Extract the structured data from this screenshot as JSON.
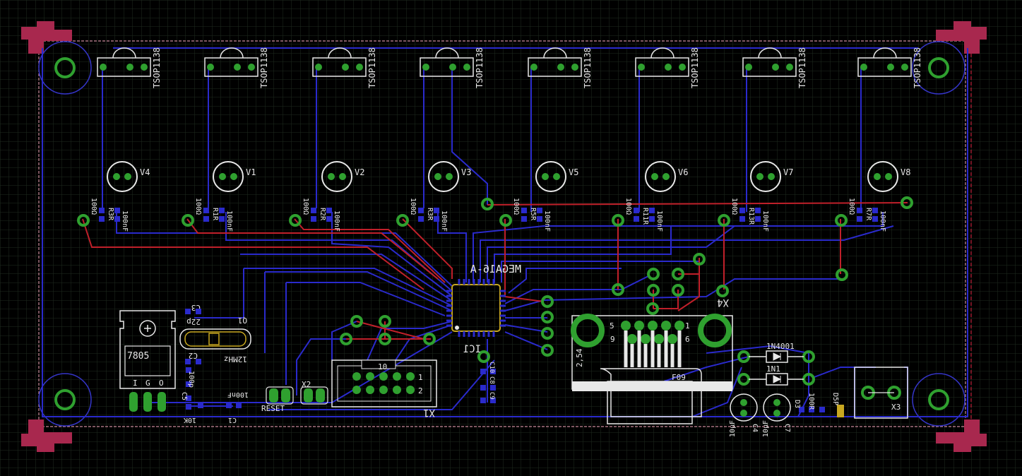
{
  "view": {
    "background": "#000000",
    "grid_color": "#1d2a1d"
  },
  "colors": {
    "bottom_trace": "#2a2acc",
    "top_trace": "#c0202a",
    "pad": "#2fa02f",
    "pad_hole": "#ffffff",
    "silk": "#e8e8e8",
    "mount_ring": "#3535c8",
    "corner_marker": "#a8284e",
    "outline": "#c88a9a"
  },
  "receivers": [
    {
      "label": "TSOP1138"
    },
    {
      "label": "TSOP1138"
    },
    {
      "label": "TSOP1138"
    },
    {
      "label": "TSOP1138"
    },
    {
      "label": "TSOP1138"
    },
    {
      "label": "TSOP1138"
    },
    {
      "label": "TSOP1138"
    },
    {
      "label": "TSOP1138"
    }
  ],
  "leds": [
    {
      "label": "V4"
    },
    {
      "label": "V1"
    },
    {
      "label": "V2"
    },
    {
      "label": "V3"
    },
    {
      "label": "V5"
    },
    {
      "label": "V6"
    },
    {
      "label": "V7"
    },
    {
      "label": "V8"
    }
  ],
  "resistor_groups": [
    {
      "ref": "R3R",
      "val_a": "100Ω",
      "val_b": "100nF"
    },
    {
      "ref": "R1R",
      "val_a": "100Ω",
      "val_b": "100nF"
    },
    {
      "ref": "R2R",
      "val_a": "100Ω",
      "val_b": "100nF"
    },
    {
      "ref": "R3R",
      "val_a": "100Ω",
      "val_b": "100nF"
    },
    {
      "ref": "R5R",
      "val_a": "100Ω",
      "val_b": "100nF"
    },
    {
      "ref": "R11R",
      "val_a": "100Ω",
      "val_b": "100nF"
    },
    {
      "ref": "R13R",
      "val_a": "100Ω",
      "val_b": "100nF"
    },
    {
      "ref": "R7R",
      "val_a": "100Ω",
      "val_b": "100nF"
    }
  ],
  "ic": {
    "value": "MEGA16-A",
    "ref": "IC1"
  },
  "regulator": {
    "value": "7805",
    "pins": [
      "I",
      "G",
      "O"
    ]
  },
  "crystal": {
    "ref": "Q1",
    "value": "12MHz",
    "cap_ref": "C3",
    "cap_value": "22p",
    "cap2_ref": "C2"
  },
  "small_parts": {
    "c1": "C1",
    "c1_val": "100nF",
    "r_val": "10K",
    "c_rst": "100p",
    "c_rst_ref": "C5"
  },
  "reset_label": "RESET",
  "x2_label": "X2",
  "header": {
    "ref": "X1",
    "pin10": "10",
    "pin1": "1",
    "pin2": "2"
  },
  "sub_d": {
    "ref": "X4",
    "value": "F09",
    "pitch": "2,54",
    "pin5": "5",
    "pin1": "1",
    "pin9": "9",
    "pin6": "6"
  },
  "diodes": [
    {
      "label": "1N4001"
    },
    {
      "label": "1N1"
    }
  ],
  "elcaps": [
    {
      "value": "10µF",
      "ref": "C4"
    },
    {
      "value": "10µF",
      "ref": "C7"
    }
  ],
  "power_terminal": {
    "ref": "X3"
  },
  "misc_right": {
    "res": "100R",
    "ref_a": "D3",
    "ref_b": "D5P"
  },
  "caps_column": [
    "C10",
    "C8",
    "C9"
  ]
}
